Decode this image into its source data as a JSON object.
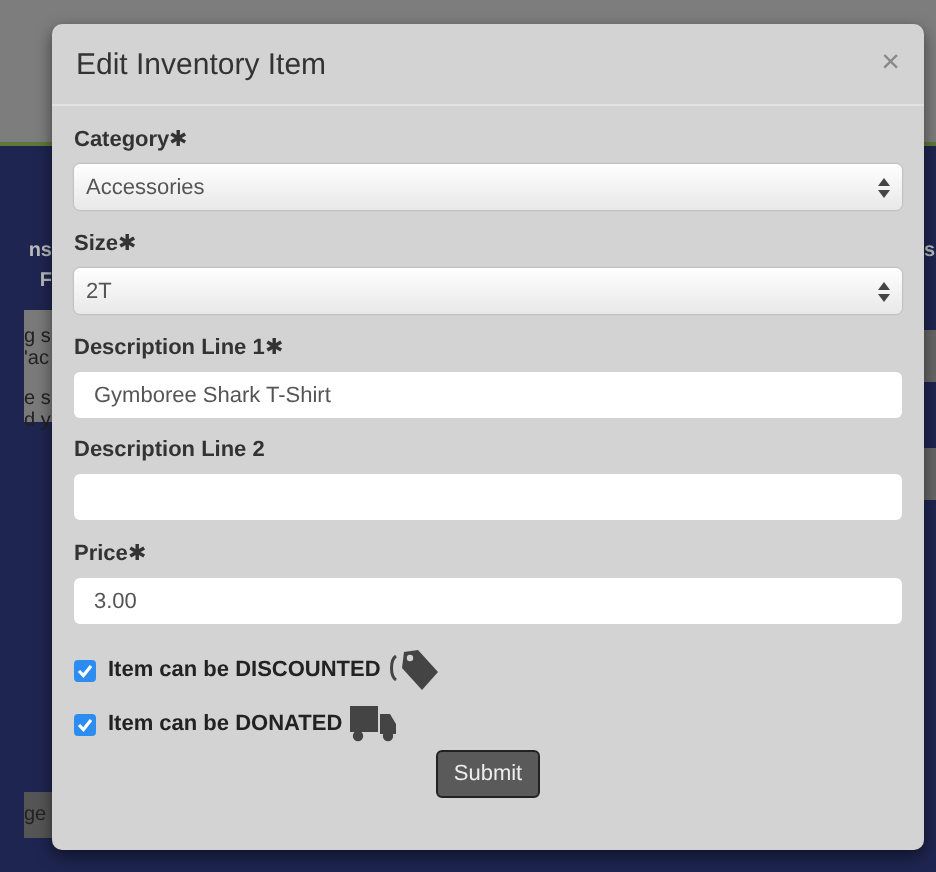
{
  "background": {
    "left_texts": [
      "ns",
      "F"
    ],
    "left_card_lines": [
      "g s",
      "'ac",
      "e s",
      "d y"
    ],
    "left_button": "ge",
    "right_texts": [
      "s"
    ]
  },
  "modal": {
    "title": "Edit Inventory Item",
    "close": "×",
    "fields": [
      {
        "kind": "select",
        "label": "Category",
        "required_mark": "✱",
        "value": "Accessories"
      },
      {
        "kind": "select",
        "label": "Size",
        "required_mark": "✱",
        "value": "2T"
      },
      {
        "kind": "text",
        "label": "Description Line 1",
        "required_mark": "✱",
        "value": "Gymboree Shark T-Shirt"
      },
      {
        "kind": "text",
        "label": "Description Line 2"
      },
      {
        "kind": "text",
        "label": "Price",
        "required_mark": "✱",
        "value": "3.00"
      }
    ],
    "checkboxes": [
      {
        "kind": "discount",
        "label": "Item can be DISCOUNTED",
        "checked": true
      },
      {
        "kind": "donate",
        "label": "Item can be DONATED",
        "checked": true
      }
    ],
    "submit": "Submit"
  }
}
